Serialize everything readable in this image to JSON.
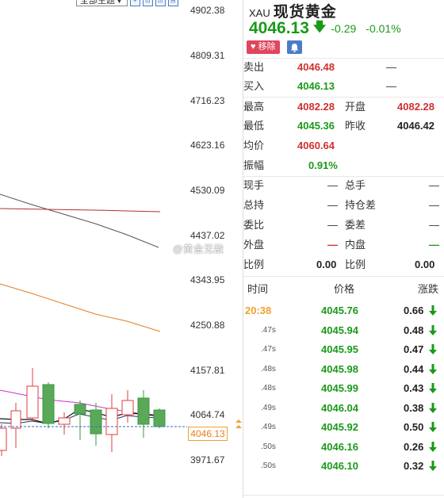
{
  "toolbar": {
    "theme_select": "全部主题▼",
    "buttons": [
      "+",
      "⊡",
      "⊡",
      "⊟"
    ]
  },
  "chart": {
    "y_ticks": [
      "4902.38",
      "4809.31",
      "4716.23",
      "4623.16",
      "4530.09",
      "4437.02",
      "4343.95",
      "4250.88",
      "4157.81",
      "4064.74",
      "3971.67"
    ],
    "current_price_tag": "4046.13",
    "colors": {
      "up": "#e03c3c",
      "down": "#3a9a3a",
      "ma_gray": "#555555",
      "ma_red": "#b03030",
      "ma_orange": "#e08020",
      "ma_magenta": "#cc33cc",
      "ma_black": "#111111",
      "price_line": "#3070c0"
    }
  },
  "watermark": "@黄金无敌",
  "quote": {
    "code": "XAU",
    "name": "现货黄金",
    "price": "4046.13",
    "change": "-0.29",
    "change_pct": "-0.01%",
    "remove_label": "移除",
    "rows": {
      "sell": {
        "label": "卖出",
        "value": "4046.48",
        "extra": "—"
      },
      "buy": {
        "label": "买入",
        "value": "4046.13",
        "extra": "—"
      },
      "high": {
        "label": "最高",
        "value": "4082.28"
      },
      "open": {
        "label": "开盘",
        "value": "4082.28"
      },
      "low": {
        "label": "最低",
        "value": "4045.36"
      },
      "prev_close": {
        "label": "昨收",
        "value": "4046.42"
      },
      "avg": {
        "label": "均价",
        "value": "4060.64"
      },
      "amplitude": {
        "label": "振幅",
        "value": "0.91%"
      },
      "current_hand": {
        "label": "现手",
        "value": "—"
      },
      "total_hand": {
        "label": "总手",
        "value": "—"
      },
      "total_hold": {
        "label": "总持",
        "value": "—"
      },
      "hold_diff": {
        "label": "持仓差",
        "value": "—"
      },
      "committee_ratio": {
        "label": "委比",
        "value": "—"
      },
      "committee_diff": {
        "label": "委差",
        "value": "—"
      },
      "outer": {
        "label": "外盘",
        "value": "—"
      },
      "inner": {
        "label": "内盘",
        "value": "—"
      },
      "ratio_left": {
        "label": "比例",
        "value": "0.00"
      },
      "ratio_right": {
        "label": "比例",
        "value": "0.00"
      }
    },
    "ticks_header": {
      "time": "时间",
      "price": "价格",
      "change": "涨跌"
    },
    "ticks": [
      {
        "time": "20:38",
        "price": "4045.76",
        "change": "0.66"
      },
      {
        "time": ".47s",
        "price": "4045.94",
        "change": "0.48"
      },
      {
        "time": ".47s",
        "price": "4045.95",
        "change": "0.47"
      },
      {
        "time": ".48s",
        "price": "4045.98",
        "change": "0.44"
      },
      {
        "time": ".48s",
        "price": "4045.99",
        "change": "0.43"
      },
      {
        "time": ".49s",
        "price": "4046.04",
        "change": "0.38"
      },
      {
        "time": ".49s",
        "price": "4045.92",
        "change": "0.50"
      },
      {
        "time": ".50s",
        "price": "4046.16",
        "change": "0.26"
      },
      {
        "time": ".50s",
        "price": "4046.10",
        "change": "0.32"
      }
    ]
  }
}
